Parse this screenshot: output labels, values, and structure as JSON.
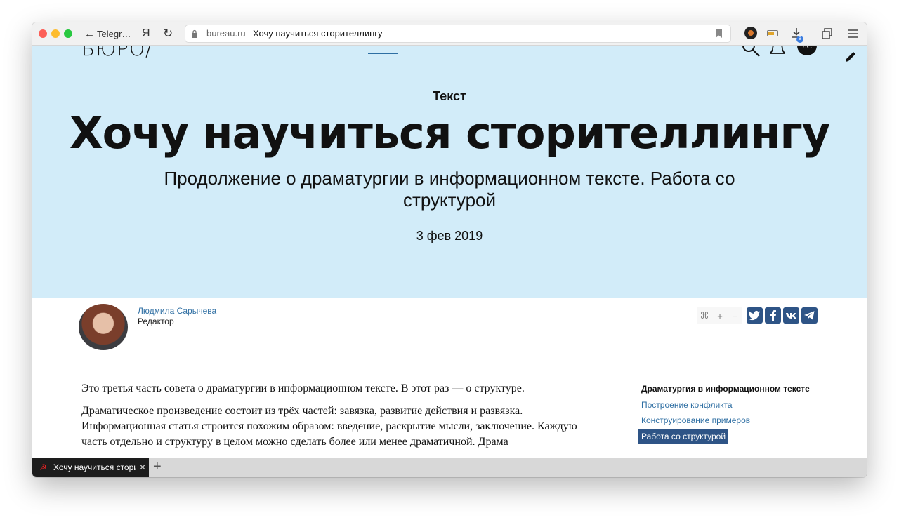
{
  "toolbar": {
    "back_label": "Telegr…",
    "yandex_label": "Я",
    "url_domain": "bureau.ru",
    "url_title": "Хочу научиться сторителлингу",
    "download_badge": "8"
  },
  "site": {
    "logo": "БЮРО/",
    "avatar_initials": "ЛС"
  },
  "hero": {
    "rubric": "Текст",
    "title": "Хочу научиться сторителлингу",
    "subtitle": "Продолжение о драматургии в информационном тексте. Работа со структурой",
    "date": "3 фев 2019"
  },
  "author": {
    "name": "Людмила Сарычева",
    "role": "Редактор"
  },
  "tools": {
    "cmd": "⌘",
    "plus": "+",
    "minus": "−"
  },
  "article": {
    "paragraphs": [
      "Это третья часть совета о драматургии в информационном тексте. В этот раз — о структуре.",
      "Драматическое произведение состоит из трёх частей: завязка, развитие действия и развязка. Информационная статья строится похожим образом: введение, раскрытие мысли, заключение. Каждую часть отдельно и структуру в целом можно сделать более или менее драматичной. Драма"
    ]
  },
  "toc": {
    "title": "Драматургия в информационном тексте",
    "items": [
      "Построение конфликта",
      "Конструирование примеров",
      "Работа со структурой"
    ]
  },
  "tabs": {
    "active_title": "Хочу научиться сторителлингу",
    "favicon": "☭",
    "close": "✕",
    "new": "+"
  }
}
